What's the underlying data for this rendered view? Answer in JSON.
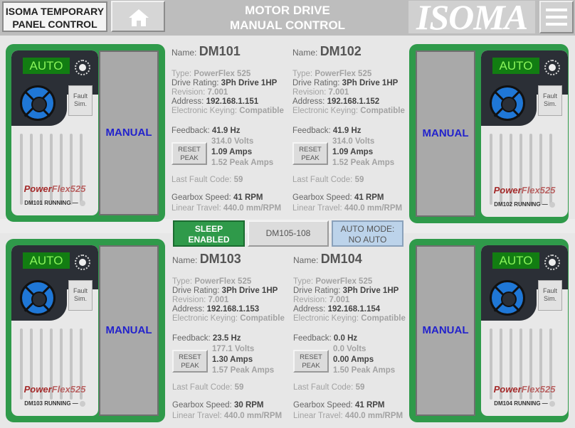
{
  "header": {
    "company": "ISOMA TEMPORARY",
    "company2": "PANEL CONTROL",
    "title1": "MOTOR DRIVE",
    "title2": "MANUAL CONTROL",
    "logo": "ISOMA"
  },
  "colors": {
    "card": "#2f9a4a",
    "drive_dark": "#2b2f36",
    "auto_green": "#127d12",
    "manual_text": "#2222cc",
    "sleep_green": "#2f9a4a",
    "auto_mode_bg": "#bcd3ea"
  },
  "drives": [
    {
      "name": "DM101",
      "type": "PowerFlex 525",
      "rating": "3Ph Drive 1HP",
      "revision": "7.001",
      "address": "192.168.1.151",
      "keying": "Compatible",
      "feedback": "41.9 Hz",
      "volts": "314.0 Volts",
      "amps": "1.09 Amps",
      "peak": "1.52 Peak Amps",
      "fault": "59",
      "speed": "41 RPM",
      "travel": "440.0 mm/RPM",
      "status": "DM101 RUNNING —"
    },
    {
      "name": "DM102",
      "type": "PowerFlex 525",
      "rating": "3Ph Drive 1HP",
      "revision": "7.001",
      "address": "192.168.1.152",
      "keying": "Compatible",
      "feedback": "41.9 Hz",
      "volts": "314.0 Volts",
      "amps": "1.09 Amps",
      "peak": "1.52 Peak Amps",
      "fault": "59",
      "speed": "41 RPM",
      "travel": "440.0 mm/RPM",
      "status": "DM102 RUNNING —"
    },
    {
      "name": "DM103",
      "type": "PowerFlex 525",
      "rating": "3Ph Drive 1HP",
      "revision": "7.001",
      "address": "192.168.1.153",
      "keying": "Compatible",
      "feedback": "23.5 Hz",
      "volts": "177.1 Volts",
      "amps": "1.30 Amps",
      "peak": "1.57 Peak Amps",
      "fault": "59",
      "speed": "30 RPM",
      "travel": "440.0 mm/RPM",
      "status": "DM103 RUNNING —"
    },
    {
      "name": "DM104",
      "type": "PowerFlex 525",
      "rating": "3Ph Drive 1HP",
      "revision": "7.001",
      "address": "192.168.1.154",
      "keying": "Compatible",
      "feedback": "0.0 Hz",
      "volts": "0.0 Volts",
      "amps": "0.00 Amps",
      "peak": "1.50 Peak Amps",
      "fault": "59",
      "speed": "41 RPM",
      "travel": "440.0 mm/RPM",
      "status": "DM104 RUNNING —"
    }
  ],
  "labels": {
    "name": "Name:",
    "type": "Type:",
    "rating": "Drive Rating:",
    "revision": "Revision:",
    "address": "Address:",
    "keying": "Electronic Keying:",
    "feedback": "Feedback:",
    "fault": "Last Fault Code:",
    "speed": "Gearbox Speed:",
    "travel": "Linear Travel:",
    "reset1": "RESET",
    "reset2": "PEAK",
    "auto": "AUTO",
    "fault_btn1": "Fault",
    "fault_btn2": "Sim.",
    "manual": "MANUAL",
    "brand1": "Power",
    "brand2": "Flex525"
  },
  "controls": {
    "sleep1": "SLEEP",
    "sleep2": "ENABLED",
    "group": "DM105-108",
    "auto_mode1": "AUTO MODE:",
    "auto_mode2": "NO AUTO"
  }
}
